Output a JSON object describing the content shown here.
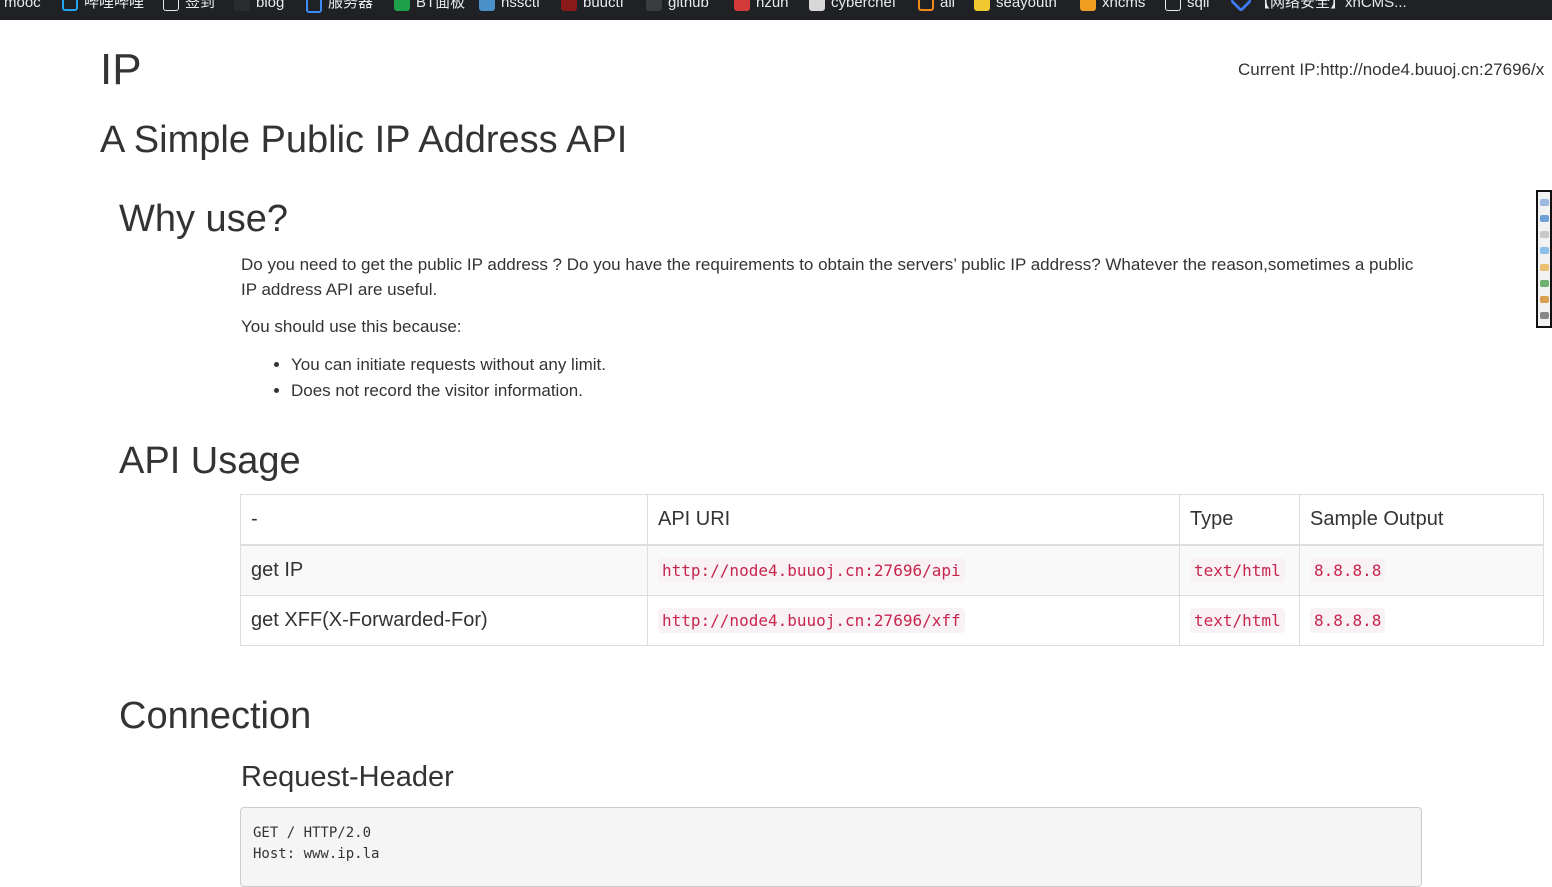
{
  "bookmarks": [
    {
      "label": "mooc",
      "icon": "generic-icon"
    },
    {
      "label": "哔哩哔哩",
      "icon": "bilibili-icon"
    },
    {
      "label": "签到",
      "icon": "globe-icon"
    },
    {
      "label": "blog",
      "icon": "blog-icon"
    },
    {
      "label": "服务器",
      "icon": "cloud-icon"
    },
    {
      "label": "BT面板",
      "icon": "bt-panel-icon"
    },
    {
      "label": "nssctf",
      "icon": "nssctf-icon"
    },
    {
      "label": "buuctf",
      "icon": "buuctf-icon"
    },
    {
      "label": "github",
      "icon": "github-icon"
    },
    {
      "label": "hzun",
      "icon": "hzun-icon"
    },
    {
      "label": "cyberchef",
      "icon": "cyberchef-icon"
    },
    {
      "label": "all",
      "icon": "all-icon"
    },
    {
      "label": "seayouth",
      "icon": "seayouth-icon"
    },
    {
      "label": "xhcms",
      "icon": "xhcms-icon"
    },
    {
      "label": "sqli",
      "icon": "globe-icon"
    },
    {
      "label": "【网络安全】xhCMS...",
      "icon": "chevron-icon"
    }
  ],
  "header": {
    "title": "IP",
    "current_ip": "Current IP:http://node4.buuoj.cn:27696/x"
  },
  "subtitle": "A Simple Public IP Address API",
  "why": {
    "heading": "Why use?",
    "paragraph": "Do you need to get the public IP address ? Do you have the requirements to obtain the servers’ public IP address? Whatever the reason,sometimes a public IP address API are useful.",
    "intro": "You should use this because:",
    "reasons": [
      "You can initiate requests without any limit.",
      "Does not record the visitor information."
    ]
  },
  "api_usage": {
    "heading": "API Usage",
    "columns": [
      "-",
      "API URI",
      "Type",
      "Sample Output"
    ],
    "rows": [
      {
        "name": "get IP",
        "uri": "http://node4.buuoj.cn:27696/api",
        "type": "text/html",
        "sample": "8.8.8.8"
      },
      {
        "name": "get XFF(X-Forwarded-For)",
        "uri": "http://node4.buuoj.cn:27696/xff",
        "type": "text/html",
        "sample": "8.8.8.8"
      }
    ]
  },
  "connection": {
    "heading": "Connection",
    "request_header_heading": "Request-Header",
    "request_lines": [
      "GET / HTTP/2.0",
      "Host: www.ip.la"
    ]
  },
  "colors": {
    "text": "#333333",
    "code_text": "#c7254e",
    "code_bg": "#f9f2f4",
    "bookmark_bar": "#1f2125",
    "table_stripe": "#f9f9f9",
    "table_border": "#dddddd"
  }
}
